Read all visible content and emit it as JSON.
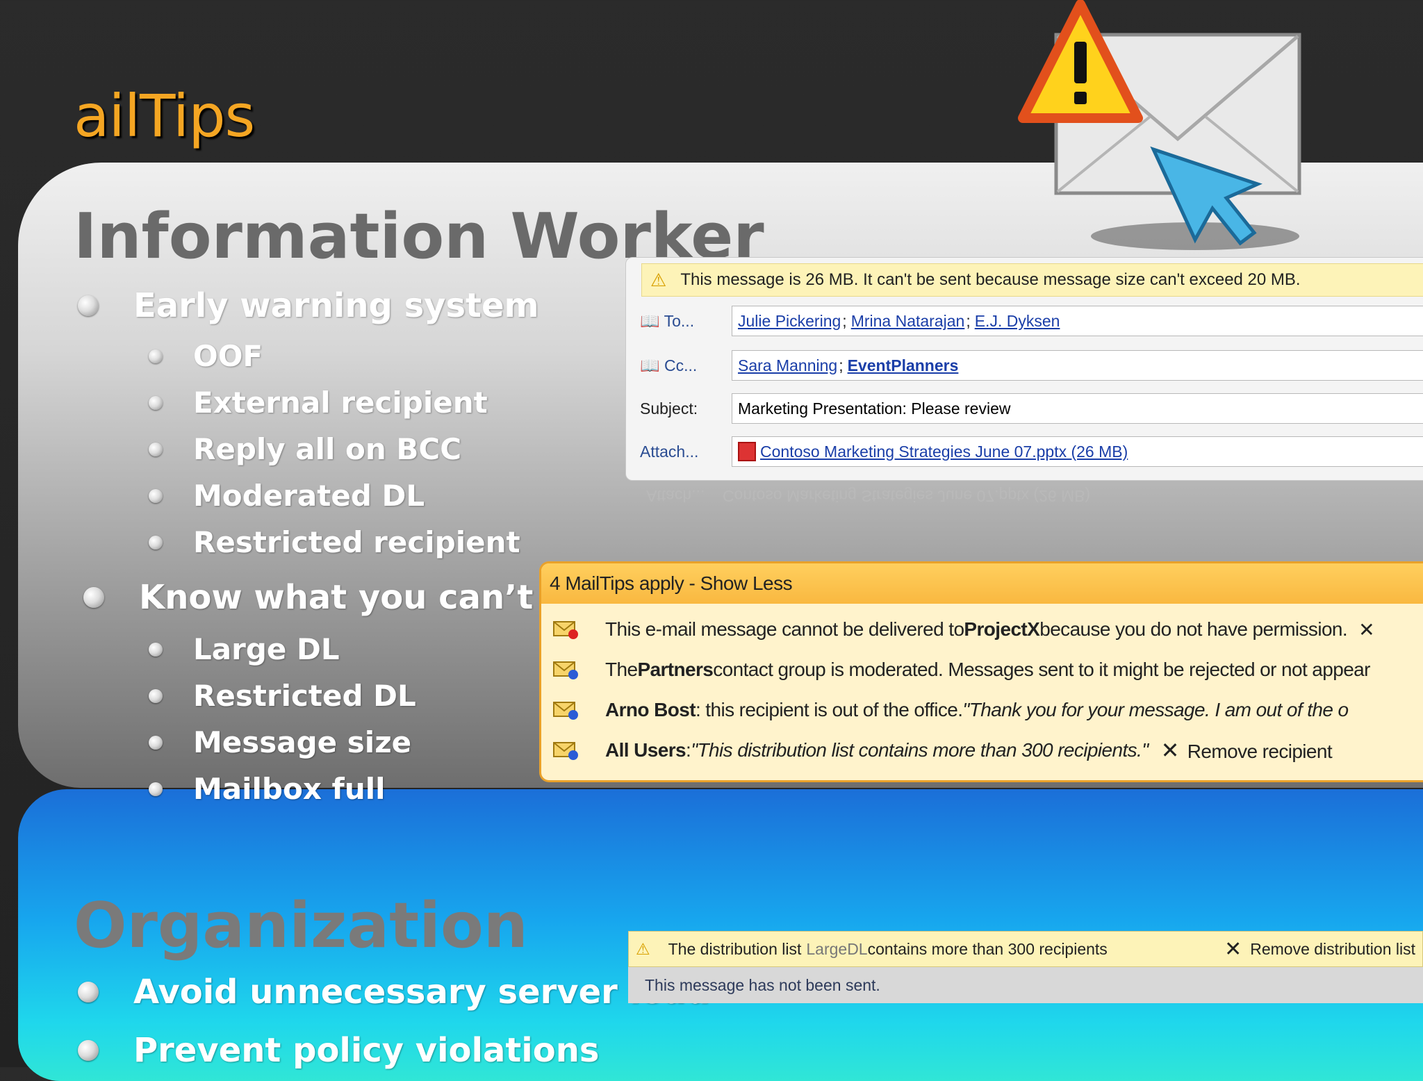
{
  "slide": {
    "title": "ailTips",
    "info_worker": {
      "heading": "Information Worker",
      "groups": [
        {
          "label": "Early warning system",
          "items": [
            "OOF",
            "External recipient",
            "Reply all on BCC",
            "Moderated DL",
            "Restricted recipient"
          ]
        },
        {
          "label": "Know what you can’t do",
          "items": [
            "Large DL",
            "Restricted DL",
            "Message size",
            "Mailbox full"
          ]
        }
      ]
    },
    "organization": {
      "heading": "Organization",
      "items": [
        "Avoid unnecessary server load",
        "Prevent policy violations"
      ]
    }
  },
  "compose": {
    "warning": "This message is 26 MB.  It can't be sent because message size can't exceed 20 MB.",
    "to_label": "To...",
    "to": [
      "Julie Pickering",
      "Mrina Natarajan",
      "E.J. Dyksen"
    ],
    "cc_label": "Cc...",
    "cc": [
      "Sara Manning",
      "EventPlanners"
    ],
    "subject_label": "Subject:",
    "subject": "Marketing Presentation: Please review",
    "attach_label": "Attach...",
    "attachment": "Contoso Marketing Strategies June 07.pptx (26 MB)"
  },
  "mailtips": {
    "header": "4 MailTips apply  -  Show Less",
    "tips": [
      {
        "pre": "This e-mail message cannot be delivered to ",
        "bold": "ProjectX",
        "post": "because you do not have permission.",
        "italic": "",
        "action": "✕"
      },
      {
        "pre": "The ",
        "bold": "Partners",
        "post": " contact group is moderated. Messages sent to it might be rejected or not appear",
        "italic": "",
        "action": ""
      },
      {
        "pre": "",
        "bold": "Arno Bost",
        "post": " : this recipient is out of the office.  ",
        "italic": "\"Thank you for your message. I am out of the o",
        "action": ""
      },
      {
        "pre": "",
        "bold": "All Users",
        "post": " :  ",
        "italic": "\"This distribution list contains more than 300 recipients.\"",
        "action": "Remove recipient"
      }
    ]
  },
  "dl_notice": {
    "pre": "The distribution list ",
    "dl_name": "LargeDL",
    "post": " contains more than 300 recipients",
    "remove_label": "Remove distribution list",
    "status": "This message has not been sent."
  },
  "colors": {
    "title": "#f5a623",
    "blue_panel": "#17a6ee",
    "tips_border": "#e9a12a",
    "link": "#1a3ea8"
  }
}
